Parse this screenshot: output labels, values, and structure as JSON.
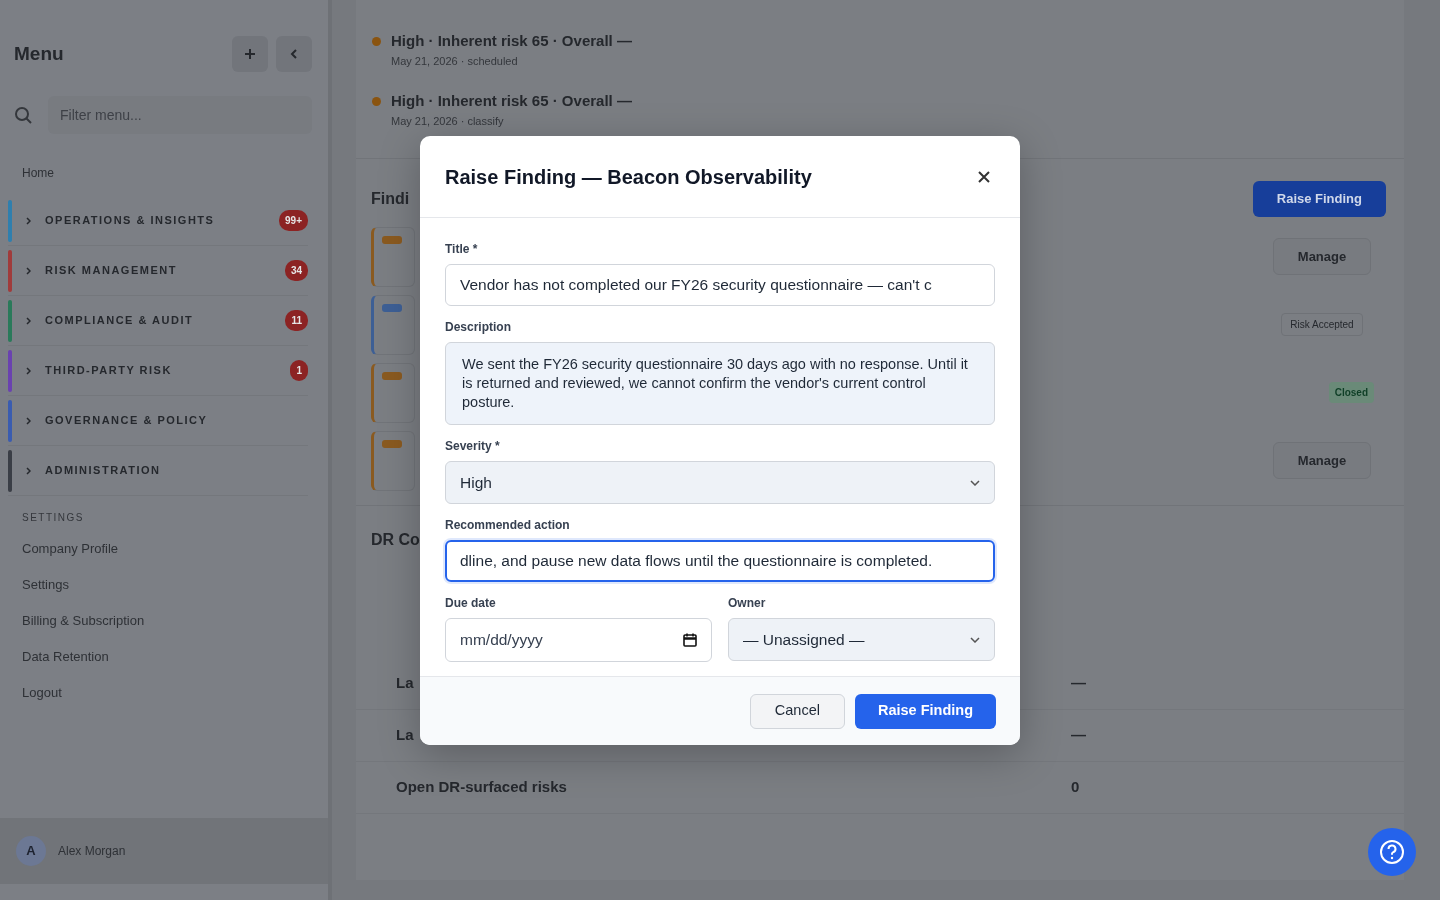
{
  "sidebar": {
    "title": "Menu",
    "filter_placeholder": "Filter menu...",
    "home": "Home",
    "groups": [
      {
        "label": "OPERATIONS & INSIGHTS",
        "color": "#2f7fae",
        "badge": "99+"
      },
      {
        "label": "RISK MANAGEMENT",
        "color": "#a03b3b",
        "badge": "34"
      },
      {
        "label": "COMPLIANCE & AUDIT",
        "color": "#2a7a5a",
        "badge": "11"
      },
      {
        "label": "THIRD-PARTY RISK",
        "color": "#6a42b0",
        "badge": "1"
      },
      {
        "label": "GOVERNANCE & POLICY",
        "color": "#3a5cb0"
      },
      {
        "label": "ADMINISTRATION",
        "color": "#3a3e46"
      }
    ],
    "settings_heading": "SETTINGS",
    "settings_items": [
      "Company Profile",
      "Settings",
      "Billing & Subscription",
      "Data Retention",
      "Logout"
    ],
    "user": {
      "initial": "A",
      "name": "Alex Morgan"
    }
  },
  "main": {
    "timeline": [
      {
        "title": "High · Inherent risk 65 · Overall —",
        "meta": "May 21, 2026 · scheduled"
      },
      {
        "title": "High · Inherent risk 65 · Overall —",
        "meta": "May 21, 2026 · classify"
      }
    ],
    "findings": {
      "heading": "Findi",
      "raise_button": "Raise Finding",
      "rows": [
        {
          "color": "#8a5a20",
          "kind": "button",
          "text": "Manage"
        },
        {
          "color": "#3d5f95",
          "kind": "badge",
          "text": "Risk Accepted"
        },
        {
          "color": "#8a5a20",
          "kind": "status",
          "text": "Closed"
        },
        {
          "color": "#8a5a20",
          "kind": "button",
          "text": "Manage"
        }
      ]
    },
    "dr": {
      "heading": "DR Co",
      "rows": [
        {
          "label": "La",
          "value": "—"
        },
        {
          "label": "La",
          "value": "—"
        },
        {
          "label": "Open DR-surfaced risks",
          "value": "0"
        }
      ]
    }
  },
  "modal": {
    "title": "Raise Finding — Beacon Observability",
    "fields": [
      {
        "kind": "input",
        "label": "Title *",
        "value": "Vendor has not completed our FY26 security questionnaire — can't c",
        "focused": false
      },
      {
        "kind": "textarea",
        "label": "Description",
        "value": "We sent the FY26 security questionnaire 30 days ago with no response. Until it is returned and reviewed, we cannot confirm the vendor's current control posture.",
        "focused": false
      },
      {
        "kind": "select",
        "label": "Severity *",
        "value": "High",
        "focused": false
      },
      {
        "kind": "input",
        "label": "Recommended action",
        "value": "dline, and pause new data flows until the questionnaire is completed.",
        "focused": true
      }
    ],
    "due_date": {
      "label": "Due date",
      "placeholder": "mm/dd/yyyy"
    },
    "owner": {
      "label": "Owner",
      "value": "— Unassigned —"
    },
    "cancel": "Cancel",
    "submit": "Raise Finding"
  }
}
